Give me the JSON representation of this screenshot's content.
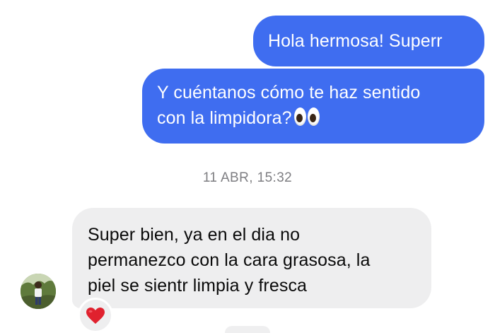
{
  "messages": {
    "outgoing_1": {
      "text": "Hola hermosa! Superr"
    },
    "outgoing_2": {
      "line1": "Y cuéntanos cómo te haz sentido",
      "line2": "con la limpidora?",
      "emoji": "eyes-emoji"
    },
    "timestamp": "11 ABR, 15:32",
    "incoming_1": {
      "line1": "Super bien, ya en el dia no",
      "line2": "permanezco con la cara grasosa, la",
      "line3": "piel se sientr limpia y fresca",
      "reaction": "red-heart-emoji"
    }
  },
  "colors": {
    "outgoing_bubble": "#3f6df0",
    "incoming_bubble": "#eeeeef",
    "timestamp_text": "#7e7e82",
    "reaction_heart": "#e0212e"
  }
}
